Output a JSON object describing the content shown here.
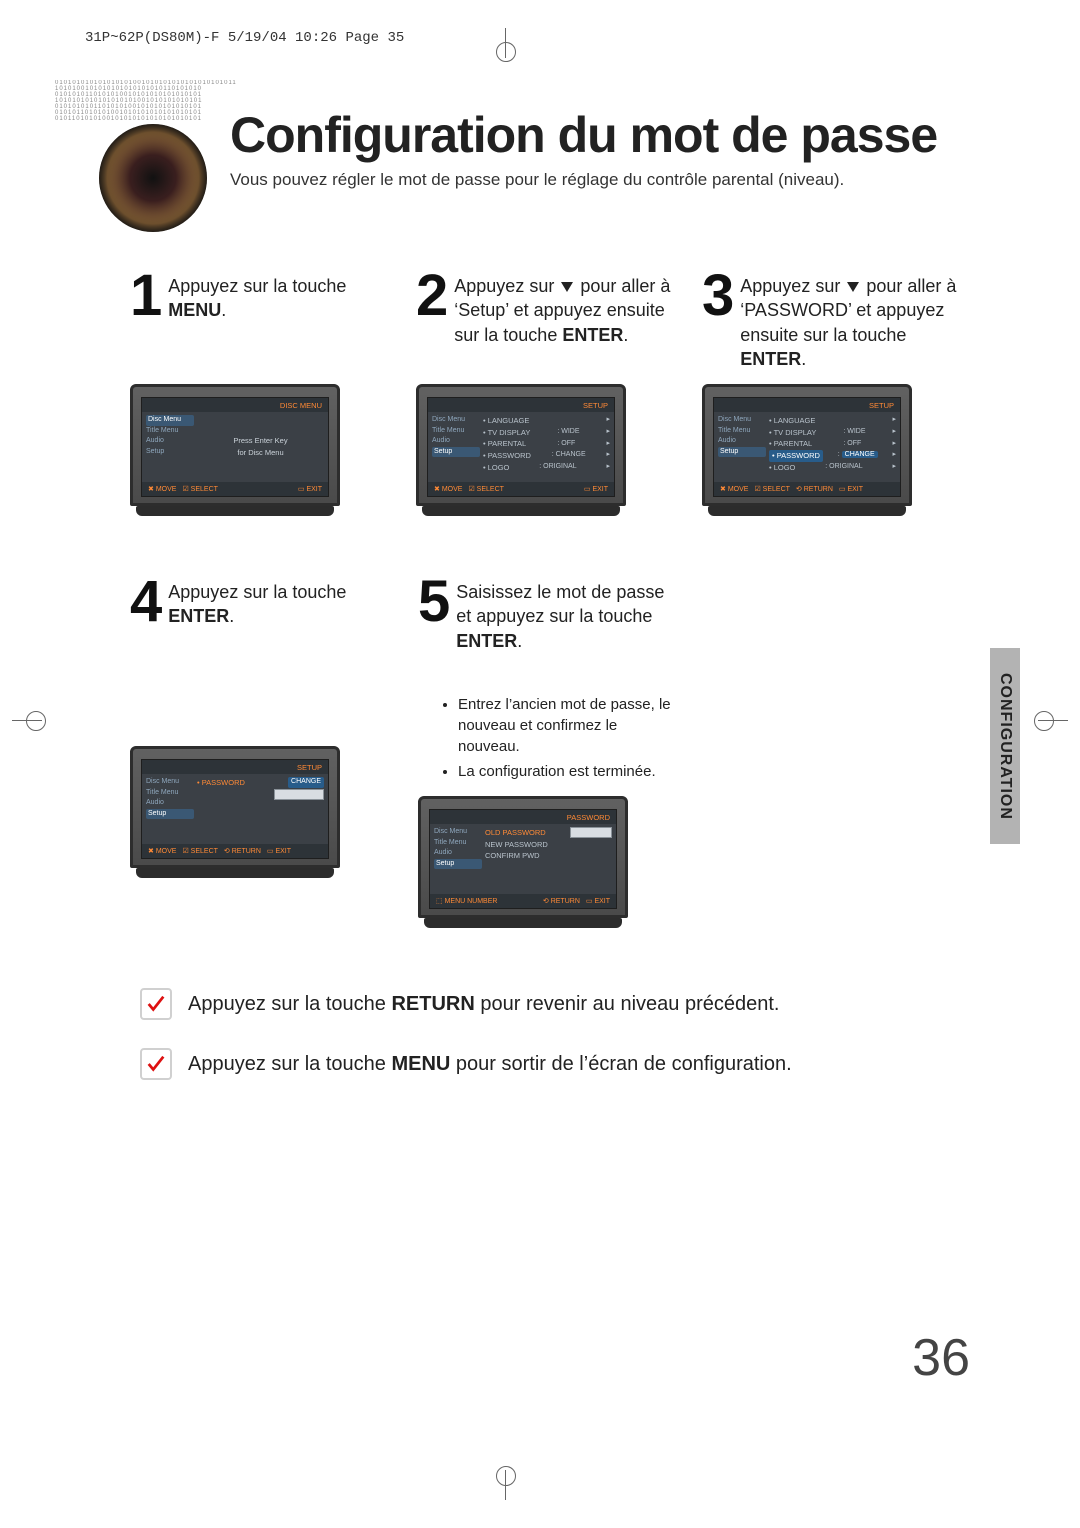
{
  "header_meta": "31P~62P(DS80M)-F  5/19/04 10:26  Page 35",
  "title": "Configuration du mot de passe",
  "intro": "Vous pouvez régler le mot de passe pour le réglage du contrôle parental (niveau).",
  "side_tab": "CONFIGURATION",
  "page_number": "36",
  "steps": {
    "s1": {
      "num": "1",
      "text_pre": "Appuyez sur la touche ",
      "bold": "MENU",
      "text_post": "."
    },
    "s2": {
      "num": "2",
      "text_a": "Appuyez sur ",
      "text_b": " pour aller à ‘Setup’ et appuyez ensuite sur la touche ",
      "bold": "ENTER",
      "text_post": "."
    },
    "s3": {
      "num": "3",
      "text_a": "Appuyez sur ",
      "text_b": " pour aller à ‘PASSWORD’ et appuyez ensuite sur la touche ",
      "bold": "ENTER",
      "text_post": "."
    },
    "s4": {
      "num": "4",
      "text_pre": "Appuyez sur la touche ",
      "bold": "ENTER",
      "text_post": "."
    },
    "s5": {
      "num": "5",
      "text_pre": "Saisissez le mot de passe et appuyez sur la touche ",
      "bold": "ENTER",
      "text_post": "."
    }
  },
  "bullets": {
    "b1": "Entrez l’ancien mot de passe, le nouveau et confirmez le nouveau.",
    "b2": "La configuration est terminée."
  },
  "tv": {
    "left_items": {
      "disc": "Disc Menu",
      "title": "Title Menu",
      "audio": "Audio",
      "setup": "Setup"
    },
    "disc_menu": "DISC MENU",
    "setup_label": "SETUP",
    "password_label": "PASSWORD",
    "press_enter1": "Press Enter Key",
    "press_enter2": "for Disc Menu",
    "menu": {
      "language": "LANGUAGE",
      "tvdisplay": "TV DISPLAY",
      "tvdisplay_v": "WIDE",
      "parental": "PARENTAL",
      "parental_v": "OFF",
      "password": "PASSWORD",
      "password_v": "CHANGE",
      "logo": "LOGO",
      "logo_v": "ORIGINAL"
    },
    "pwd": {
      "old": "OLD PASSWORD",
      "new": "NEW PASSWORD",
      "confirm": "CONFIRM PWD"
    },
    "bottom": {
      "move": "MOVE",
      "select": "SELECT",
      "return": "RETURN",
      "exit": "EXIT",
      "menu_number": "MENU NUMBER"
    }
  },
  "notes": {
    "n1_pre": "Appuyez sur la touche ",
    "n1_bold": "RETURN",
    "n1_post": " pour revenir au niveau précédent.",
    "n2_pre": "Appuyez sur la touche ",
    "n2_bold": "MENU",
    "n2_post": " pour sortir de l’écran de configuration."
  }
}
